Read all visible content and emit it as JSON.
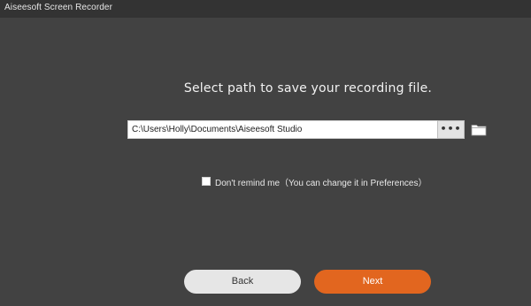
{
  "window": {
    "title": "Aiseesoft Screen Recorder"
  },
  "main": {
    "prompt": "Select path to save your recording file.",
    "path_value": "C:\\Users\\Holly\\Documents\\Aiseesoft Studio",
    "browse_label": "•••",
    "folder_icon": "folder-icon",
    "remind_label": "Don't remind me（You can change it in Preferences）",
    "remind_checked": false
  },
  "footer": {
    "back_label": "Back",
    "next_label": "Next"
  },
  "colors": {
    "background": "#424242",
    "titlebar": "#333333",
    "accent": "#e2661f",
    "secondary_button": "#e6e6e6"
  }
}
